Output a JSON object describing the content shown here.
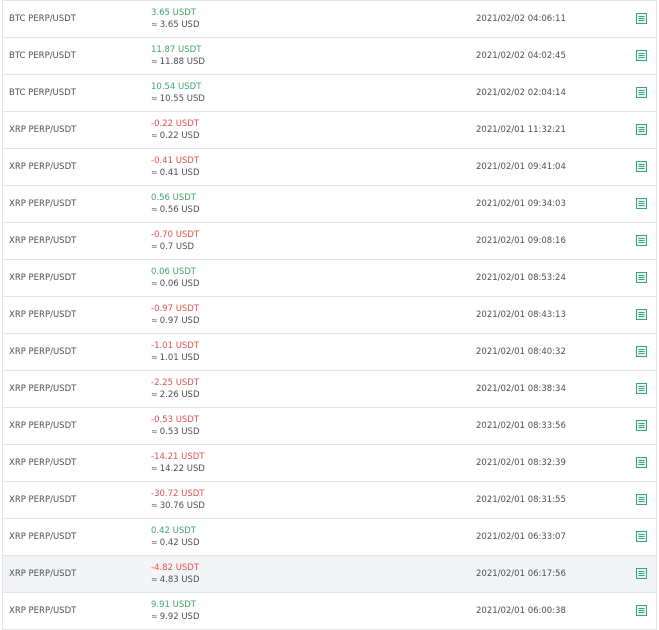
{
  "colors": {
    "positive": "#3fa66a",
    "negative": "#e0514a",
    "icon": "#35a57a"
  },
  "approx_symbol": "≈",
  "rows": [
    {
      "pair": "BTC PERP/USDT",
      "usdt": "3.65 USDT",
      "usd": "3.65 USD",
      "sign": "pos",
      "time": "2021/02/02 04:06:11",
      "icon": "document-icon"
    },
    {
      "pair": "BTC PERP/USDT",
      "usdt": "11.87 USDT",
      "usd": "11.88 USD",
      "sign": "pos",
      "time": "2021/02/02 04:02:45",
      "icon": "document-icon"
    },
    {
      "pair": "BTC PERP/USDT",
      "usdt": "10.54 USDT",
      "usd": "10.55 USD",
      "sign": "pos",
      "time": "2021/02/02 02:04:14",
      "icon": "document-icon"
    },
    {
      "pair": "XRP PERP/USDT",
      "usdt": "-0.22 USDT",
      "usd": "0.22 USD",
      "sign": "neg",
      "time": "2021/02/01 11:32:21",
      "icon": "document-icon"
    },
    {
      "pair": "XRP PERP/USDT",
      "usdt": "-0.41 USDT",
      "usd": "0.41 USD",
      "sign": "neg",
      "time": "2021/02/01 09:41:04",
      "icon": "document-icon"
    },
    {
      "pair": "XRP PERP/USDT",
      "usdt": "0.56 USDT",
      "usd": "0.56 USD",
      "sign": "pos",
      "time": "2021/02/01 09:34:03",
      "icon": "document-icon"
    },
    {
      "pair": "XRP PERP/USDT",
      "usdt": "-0.70 USDT",
      "usd": "0.7 USD",
      "sign": "neg",
      "time": "2021/02/01 09:08:16",
      "icon": "document-icon"
    },
    {
      "pair": "XRP PERP/USDT",
      "usdt": "0.06 USDT",
      "usd": "0.06 USD",
      "sign": "pos",
      "time": "2021/02/01 08:53:24",
      "icon": "document-icon"
    },
    {
      "pair": "XRP PERP/USDT",
      "usdt": "-0.97 USDT",
      "usd": "0.97 USD",
      "sign": "neg",
      "time": "2021/02/01 08:43:13",
      "icon": "document-icon"
    },
    {
      "pair": "XRP PERP/USDT",
      "usdt": "-1.01 USDT",
      "usd": "1.01 USD",
      "sign": "neg",
      "time": "2021/02/01 08:40:32",
      "icon": "document-icon"
    },
    {
      "pair": "XRP PERP/USDT",
      "usdt": "-2.25 USDT",
      "usd": "2.26 USD",
      "sign": "neg",
      "time": "2021/02/01 08:38:34",
      "icon": "document-icon"
    },
    {
      "pair": "XRP PERP/USDT",
      "usdt": "-0.53 USDT",
      "usd": "0.53 USD",
      "sign": "neg",
      "time": "2021/02/01 08:33:56",
      "icon": "document-icon"
    },
    {
      "pair": "XRP PERP/USDT",
      "usdt": "-14.21 USDT",
      "usd": "14.22 USD",
      "sign": "neg",
      "time": "2021/02/01 08:32:39",
      "icon": "document-icon"
    },
    {
      "pair": "XRP PERP/USDT",
      "usdt": "-30.72 USDT",
      "usd": "30.76 USD",
      "sign": "neg",
      "time": "2021/02/01 08:31:55",
      "icon": "document-icon"
    },
    {
      "pair": "XRP PERP/USDT",
      "usdt": "0.42 USDT",
      "usd": "0.42 USD",
      "sign": "pos",
      "time": "2021/02/01 06:33:07",
      "icon": "document-icon"
    },
    {
      "pair": "XRP PERP/USDT",
      "usdt": "-4.82 USDT",
      "usd": "4.83 USD",
      "sign": "neg",
      "time": "2021/02/01 06:17:56",
      "icon": "document-icon",
      "highlighted": true
    },
    {
      "pair": "XRP PERP/USDT",
      "usdt": "9.91 USDT",
      "usd": "9.92 USD",
      "sign": "pos",
      "time": "2021/02/01 06:00:38",
      "icon": "document-icon"
    }
  ]
}
